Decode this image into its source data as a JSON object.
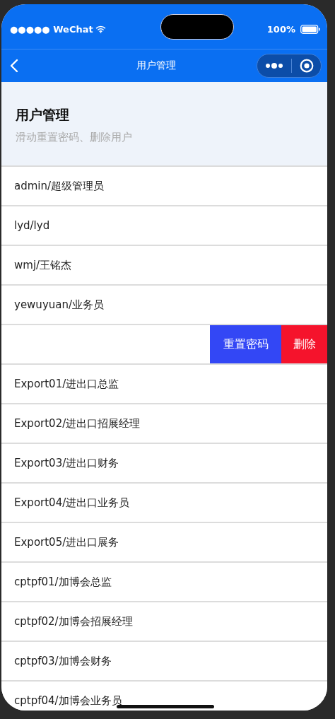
{
  "status_bar": {
    "carrier": "●●●●● WeChat",
    "battery": "100%"
  },
  "nav_bar": {
    "title": "用户管理"
  },
  "header": {
    "title": "用户管理",
    "subtitle": "滑动重置密码、删除用户"
  },
  "users": [
    {
      "label": "admin/超级管理员",
      "swiped": false
    },
    {
      "label": "lyd/lyd",
      "swiped": false
    },
    {
      "label": "wmj/王铭杰",
      "swiped": false
    },
    {
      "label": "yewuyuan/业务员",
      "swiped": false
    },
    {
      "swiped": true,
      "actions": [
        {
          "label": "重置密码",
          "kind": "reset"
        },
        {
          "label": "删除",
          "kind": "delete"
        }
      ]
    },
    {
      "label": "Export01/进出口总监",
      "swiped": false
    },
    {
      "label": "Export02/进出口招展经理",
      "swiped": false
    },
    {
      "label": "Export03/进出口财务",
      "swiped": false
    },
    {
      "label": "Export04/进出口业务员",
      "swiped": false
    },
    {
      "label": "Export05/进出口展务",
      "swiped": false
    },
    {
      "label": "cptpf01/加博会总监",
      "swiped": false
    },
    {
      "label": "cptpf02/加博会招展经理",
      "swiped": false
    },
    {
      "label": "cptpf03/加博会财务",
      "swiped": false
    },
    {
      "label": "cptpf04/加博会业务员",
      "swiped": false
    }
  ]
}
